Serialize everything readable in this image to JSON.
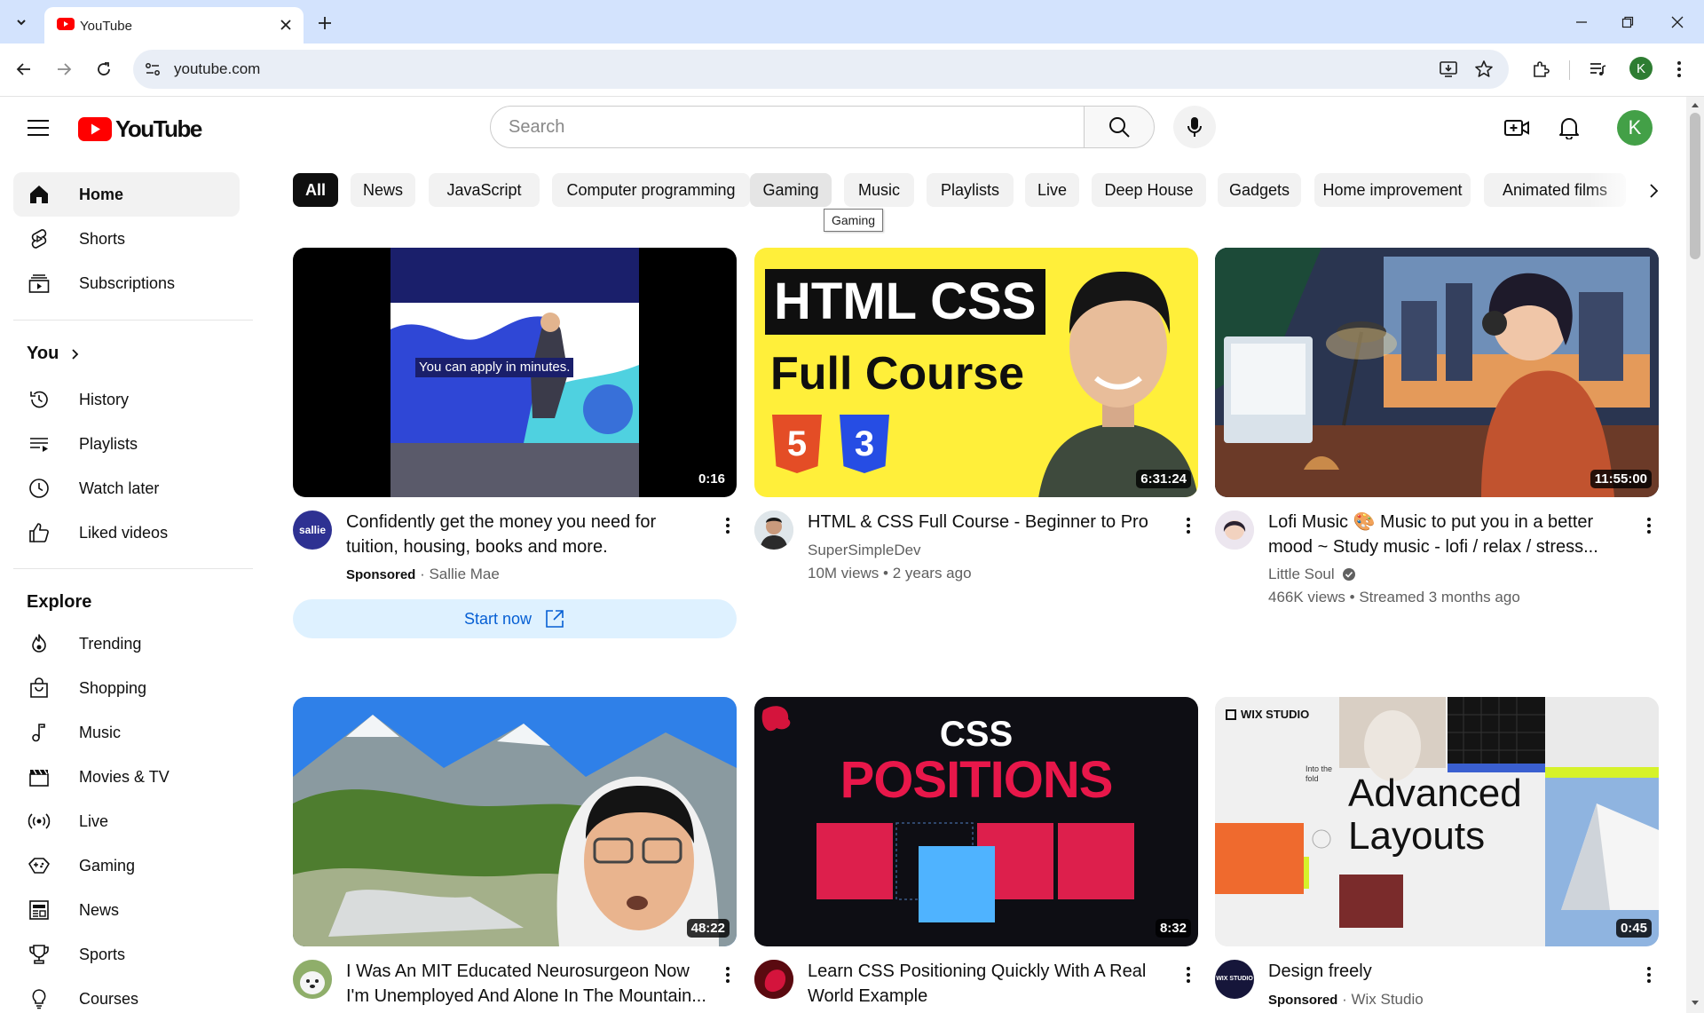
{
  "browser": {
    "tab_title": "YouTube",
    "url": "youtube.com"
  },
  "header": {
    "logo_text": "YouTube",
    "search_placeholder": "Search",
    "avatar_letter": "K"
  },
  "sidebar": {
    "primary": [
      {
        "label": "Home",
        "icon": "home-icon",
        "active": true
      },
      {
        "label": "Shorts",
        "icon": "shorts-icon"
      },
      {
        "label": "Subscriptions",
        "icon": "subscriptions-icon"
      }
    ],
    "you_heading": "You",
    "you_items": [
      {
        "label": "History",
        "icon": "history-icon"
      },
      {
        "label": "Playlists",
        "icon": "playlists-icon"
      },
      {
        "label": "Watch later",
        "icon": "watch-later-icon"
      },
      {
        "label": "Liked videos",
        "icon": "thumbs-up-icon"
      }
    ],
    "explore_heading": "Explore",
    "explore_items": [
      {
        "label": "Trending",
        "icon": "trending-icon"
      },
      {
        "label": "Shopping",
        "icon": "shopping-bag-icon"
      },
      {
        "label": "Music",
        "icon": "music-note-icon"
      },
      {
        "label": "Movies & TV",
        "icon": "clapperboard-icon"
      },
      {
        "label": "Live",
        "icon": "live-icon"
      },
      {
        "label": "Gaming",
        "icon": "gaming-icon"
      },
      {
        "label": "News",
        "icon": "news-icon"
      },
      {
        "label": "Sports",
        "icon": "trophy-icon"
      },
      {
        "label": "Courses",
        "icon": "courses-icon"
      }
    ]
  },
  "chips": [
    "All",
    "News",
    "JavaScript",
    "Computer programming",
    "Gaming",
    "Music",
    "Playlists",
    "Live",
    "Deep House",
    "Gadgets",
    "Home improvement",
    "Animated films"
  ],
  "tooltip": "Gaming",
  "videos": [
    {
      "title": "Confidently get the money you need for tuition, housing, books and more.",
      "sponsored": "Sponsored",
      "channel": "Sallie Mae",
      "duration": "0:16",
      "cta": "Start now",
      "thumb_text": "You can apply in minutes.",
      "avatar_text": "sallie"
    },
    {
      "title": "HTML & CSS Full Course - Beginner to Pro",
      "channel": "SuperSimpleDev",
      "meta": "10M views • 2 years ago",
      "duration": "6:31:24",
      "thumb_line1": "HTML CSS",
      "thumb_line2": "Full Course",
      "thumb_html_badge": "5",
      "thumb_css_badge": "3"
    },
    {
      "title": "Lofi Music 🎨 Music to put you in a better mood ~ Study music - lofi / relax / stress...",
      "channel": "Little Soul",
      "meta": "466K views • Streamed 3 months ago",
      "duration": "11:55:00"
    },
    {
      "title": "I Was An MIT Educated Neurosurgeon Now I'm Unemployed And Alone In The Mountain...",
      "duration": "48:22"
    },
    {
      "title": "Learn CSS Positioning Quickly With A Real World Example",
      "duration": "8:32",
      "thumb_line1": "CSS",
      "thumb_line2": "POSITIONS"
    },
    {
      "title": "Design freely",
      "sponsored": "Sponsored",
      "channel": "Wix Studio",
      "duration": "0:45",
      "thumb_brand": "WIX STUDIO",
      "thumb_line1": "Advanced",
      "thumb_line2": "Layouts",
      "thumb_small": "Into the fold",
      "avatar_text": "WIX STUDIO"
    }
  ],
  "colors": {
    "brand_red": "#ff0000",
    "tabbar_bg": "#d3e3fd",
    "chip_active": "#0f0f0f",
    "cta_bg": "#def1ff",
    "cta_text": "#065fd4"
  }
}
